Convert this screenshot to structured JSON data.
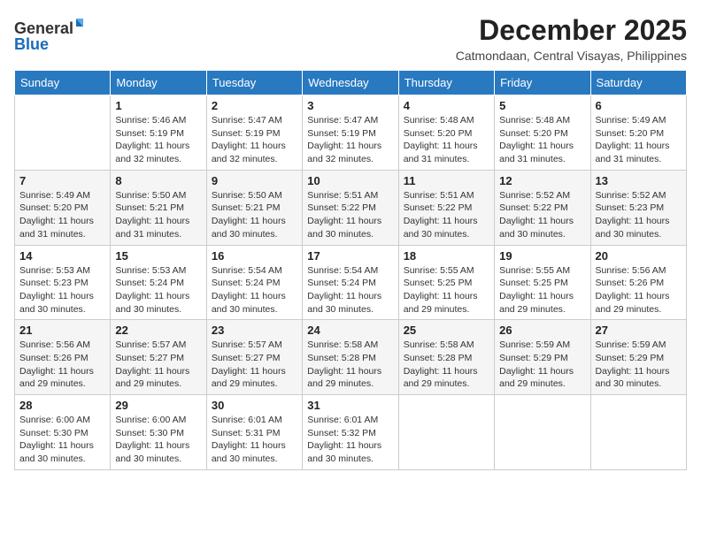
{
  "header": {
    "logo_general": "General",
    "logo_blue": "Blue",
    "month_title": "December 2025",
    "location": "Catmondaan, Central Visayas, Philippines"
  },
  "columns": [
    "Sunday",
    "Monday",
    "Tuesday",
    "Wednesday",
    "Thursday",
    "Friday",
    "Saturday"
  ],
  "weeks": [
    [
      {
        "day": "",
        "sunrise": "",
        "sunset": "",
        "daylight": ""
      },
      {
        "day": "1",
        "sunrise": "Sunrise: 5:46 AM",
        "sunset": "Sunset: 5:19 PM",
        "daylight": "Daylight: 11 hours and 32 minutes."
      },
      {
        "day": "2",
        "sunrise": "Sunrise: 5:47 AM",
        "sunset": "Sunset: 5:19 PM",
        "daylight": "Daylight: 11 hours and 32 minutes."
      },
      {
        "day": "3",
        "sunrise": "Sunrise: 5:47 AM",
        "sunset": "Sunset: 5:19 PM",
        "daylight": "Daylight: 11 hours and 32 minutes."
      },
      {
        "day": "4",
        "sunrise": "Sunrise: 5:48 AM",
        "sunset": "Sunset: 5:20 PM",
        "daylight": "Daylight: 11 hours and 31 minutes."
      },
      {
        "day": "5",
        "sunrise": "Sunrise: 5:48 AM",
        "sunset": "Sunset: 5:20 PM",
        "daylight": "Daylight: 11 hours and 31 minutes."
      },
      {
        "day": "6",
        "sunrise": "Sunrise: 5:49 AM",
        "sunset": "Sunset: 5:20 PM",
        "daylight": "Daylight: 11 hours and 31 minutes."
      }
    ],
    [
      {
        "day": "7",
        "sunrise": "Sunrise: 5:49 AM",
        "sunset": "Sunset: 5:20 PM",
        "daylight": "Daylight: 11 hours and 31 minutes."
      },
      {
        "day": "8",
        "sunrise": "Sunrise: 5:50 AM",
        "sunset": "Sunset: 5:21 PM",
        "daylight": "Daylight: 11 hours and 31 minutes."
      },
      {
        "day": "9",
        "sunrise": "Sunrise: 5:50 AM",
        "sunset": "Sunset: 5:21 PM",
        "daylight": "Daylight: 11 hours and 30 minutes."
      },
      {
        "day": "10",
        "sunrise": "Sunrise: 5:51 AM",
        "sunset": "Sunset: 5:22 PM",
        "daylight": "Daylight: 11 hours and 30 minutes."
      },
      {
        "day": "11",
        "sunrise": "Sunrise: 5:51 AM",
        "sunset": "Sunset: 5:22 PM",
        "daylight": "Daylight: 11 hours and 30 minutes."
      },
      {
        "day": "12",
        "sunrise": "Sunrise: 5:52 AM",
        "sunset": "Sunset: 5:22 PM",
        "daylight": "Daylight: 11 hours and 30 minutes."
      },
      {
        "day": "13",
        "sunrise": "Sunrise: 5:52 AM",
        "sunset": "Sunset: 5:23 PM",
        "daylight": "Daylight: 11 hours and 30 minutes."
      }
    ],
    [
      {
        "day": "14",
        "sunrise": "Sunrise: 5:53 AM",
        "sunset": "Sunset: 5:23 PM",
        "daylight": "Daylight: 11 hours and 30 minutes."
      },
      {
        "day": "15",
        "sunrise": "Sunrise: 5:53 AM",
        "sunset": "Sunset: 5:24 PM",
        "daylight": "Daylight: 11 hours and 30 minutes."
      },
      {
        "day": "16",
        "sunrise": "Sunrise: 5:54 AM",
        "sunset": "Sunset: 5:24 PM",
        "daylight": "Daylight: 11 hours and 30 minutes."
      },
      {
        "day": "17",
        "sunrise": "Sunrise: 5:54 AM",
        "sunset": "Sunset: 5:24 PM",
        "daylight": "Daylight: 11 hours and 30 minutes."
      },
      {
        "day": "18",
        "sunrise": "Sunrise: 5:55 AM",
        "sunset": "Sunset: 5:25 PM",
        "daylight": "Daylight: 11 hours and 29 minutes."
      },
      {
        "day": "19",
        "sunrise": "Sunrise: 5:55 AM",
        "sunset": "Sunset: 5:25 PM",
        "daylight": "Daylight: 11 hours and 29 minutes."
      },
      {
        "day": "20",
        "sunrise": "Sunrise: 5:56 AM",
        "sunset": "Sunset: 5:26 PM",
        "daylight": "Daylight: 11 hours and 29 minutes."
      }
    ],
    [
      {
        "day": "21",
        "sunrise": "Sunrise: 5:56 AM",
        "sunset": "Sunset: 5:26 PM",
        "daylight": "Daylight: 11 hours and 29 minutes."
      },
      {
        "day": "22",
        "sunrise": "Sunrise: 5:57 AM",
        "sunset": "Sunset: 5:27 PM",
        "daylight": "Daylight: 11 hours and 29 minutes."
      },
      {
        "day": "23",
        "sunrise": "Sunrise: 5:57 AM",
        "sunset": "Sunset: 5:27 PM",
        "daylight": "Daylight: 11 hours and 29 minutes."
      },
      {
        "day": "24",
        "sunrise": "Sunrise: 5:58 AM",
        "sunset": "Sunset: 5:28 PM",
        "daylight": "Daylight: 11 hours and 29 minutes."
      },
      {
        "day": "25",
        "sunrise": "Sunrise: 5:58 AM",
        "sunset": "Sunset: 5:28 PM",
        "daylight": "Daylight: 11 hours and 29 minutes."
      },
      {
        "day": "26",
        "sunrise": "Sunrise: 5:59 AM",
        "sunset": "Sunset: 5:29 PM",
        "daylight": "Daylight: 11 hours and 29 minutes."
      },
      {
        "day": "27",
        "sunrise": "Sunrise: 5:59 AM",
        "sunset": "Sunset: 5:29 PM",
        "daylight": "Daylight: 11 hours and 30 minutes."
      }
    ],
    [
      {
        "day": "28",
        "sunrise": "Sunrise: 6:00 AM",
        "sunset": "Sunset: 5:30 PM",
        "daylight": "Daylight: 11 hours and 30 minutes."
      },
      {
        "day": "29",
        "sunrise": "Sunrise: 6:00 AM",
        "sunset": "Sunset: 5:30 PM",
        "daylight": "Daylight: 11 hours and 30 minutes."
      },
      {
        "day": "30",
        "sunrise": "Sunrise: 6:01 AM",
        "sunset": "Sunset: 5:31 PM",
        "daylight": "Daylight: 11 hours and 30 minutes."
      },
      {
        "day": "31",
        "sunrise": "Sunrise: 6:01 AM",
        "sunset": "Sunset: 5:32 PM",
        "daylight": "Daylight: 11 hours and 30 minutes."
      },
      {
        "day": "",
        "sunrise": "",
        "sunset": "",
        "daylight": ""
      },
      {
        "day": "",
        "sunrise": "",
        "sunset": "",
        "daylight": ""
      },
      {
        "day": "",
        "sunrise": "",
        "sunset": "",
        "daylight": ""
      }
    ]
  ]
}
